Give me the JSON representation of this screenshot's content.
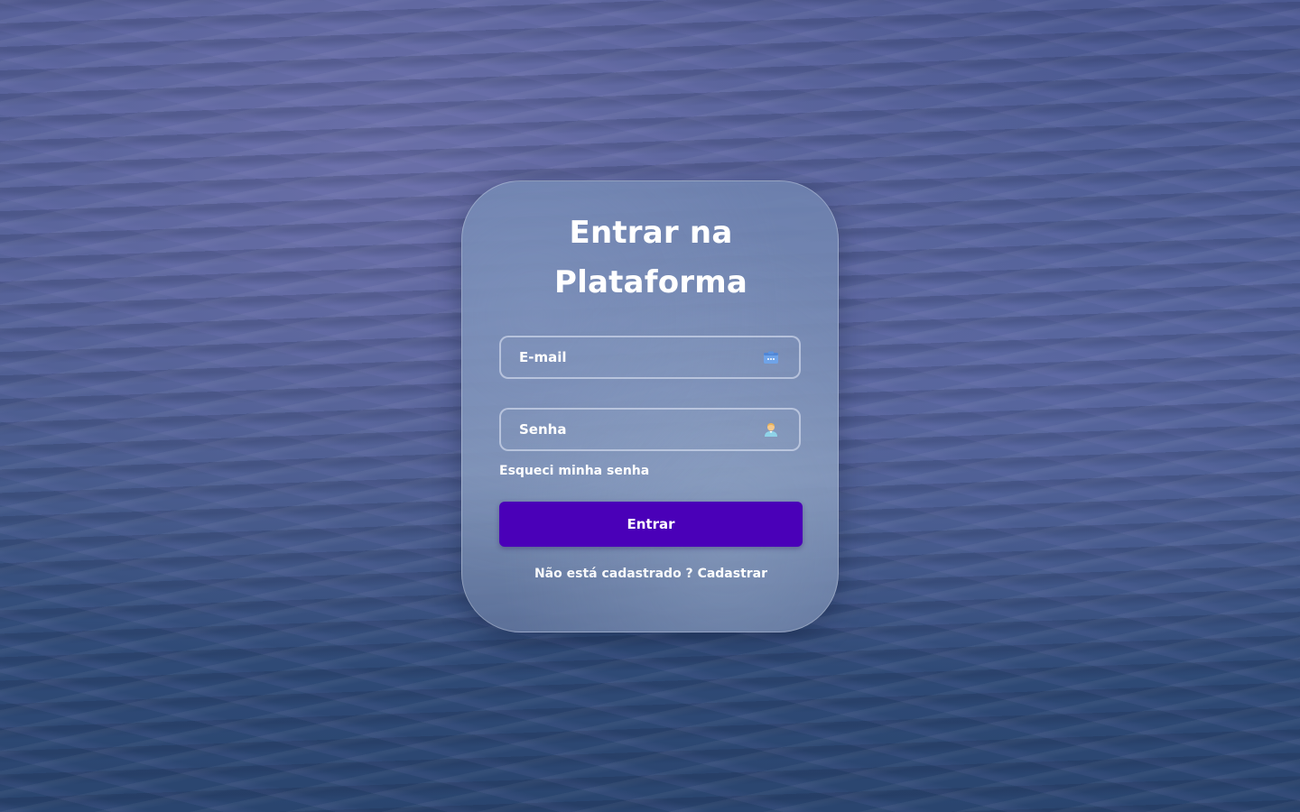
{
  "login": {
    "title_line1": "Entrar na",
    "title_line2": "Plataforma",
    "email_placeholder": "E-mail",
    "password_placeholder": "Senha",
    "forgot_password": "Esqueci minha senha",
    "submit_label": "Entrar",
    "register_prompt": "Não está cadastrado ?",
    "register_link": "Cadastrar",
    "email_icon": "email-card-icon",
    "password_icon": "user-icon"
  },
  "colors": {
    "primary_button": "#4a00b8",
    "text": "#ffffff"
  }
}
